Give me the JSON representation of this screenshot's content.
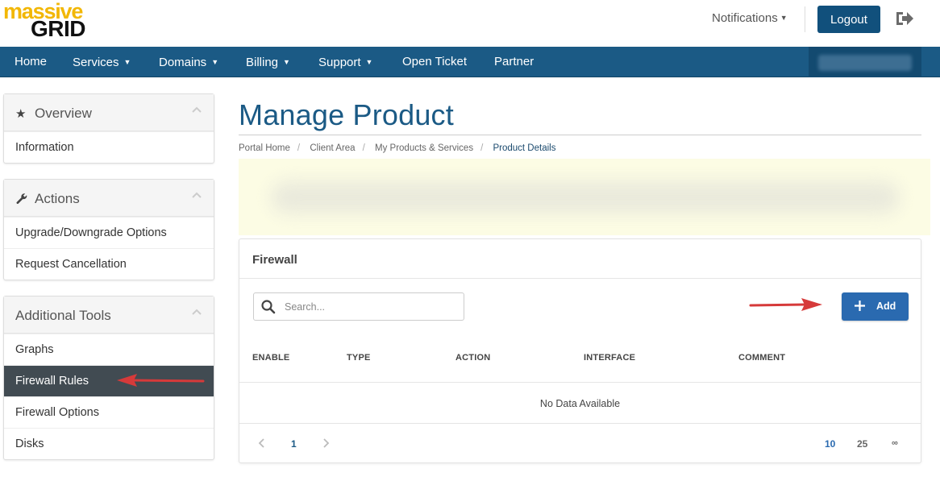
{
  "brand": {
    "logo_top": "massive",
    "logo_bottom": "GRID",
    "accent": "#f2b705",
    "primary": "#1b5a85"
  },
  "header": {
    "notifications_label": "Notifications",
    "logout_label": "Logout",
    "signout_icon": "sign-out-icon"
  },
  "nav": {
    "items": [
      {
        "label": "Home",
        "dropdown": false
      },
      {
        "label": "Services",
        "dropdown": true
      },
      {
        "label": "Domains",
        "dropdown": true
      },
      {
        "label": "Billing",
        "dropdown": true
      },
      {
        "label": "Support",
        "dropdown": true
      },
      {
        "label": "Open Ticket",
        "dropdown": false
      },
      {
        "label": "Partner",
        "dropdown": false
      }
    ]
  },
  "sidebar": {
    "overview": {
      "title": "Overview",
      "icon": "star-icon",
      "items": [
        "Information"
      ]
    },
    "actions": {
      "title": "Actions",
      "icon": "wrench-icon",
      "items": [
        "Upgrade/Downgrade Options",
        "Request Cancellation"
      ]
    },
    "tools": {
      "title": "Additional Tools",
      "items": [
        "Graphs",
        "Firewall Rules",
        "Firewall Options",
        "Disks"
      ],
      "active": "Firewall Rules"
    }
  },
  "page": {
    "title": "Manage Product",
    "breadcrumb": [
      "Portal Home",
      "Client Area",
      "My Products & Services",
      "Product Details"
    ]
  },
  "firewall": {
    "title": "Firewall",
    "search_placeholder": "Search...",
    "add_label": "Add",
    "columns": [
      "ENABLE",
      "TYPE",
      "ACTION",
      "INTERFACE",
      "COMMENT"
    ],
    "empty_text": "No Data Available",
    "pagination": {
      "current_page": "1",
      "page_sizes": [
        "10",
        "25",
        "∞"
      ],
      "active_size": "10"
    }
  }
}
